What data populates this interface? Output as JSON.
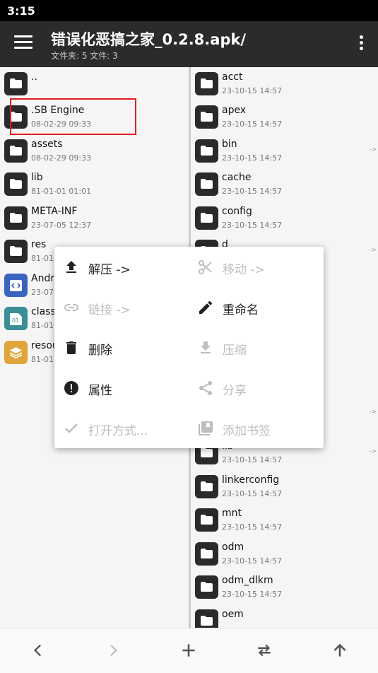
{
  "status": {
    "time": "3:15"
  },
  "header": {
    "title": "错误化恶搞之家_0.2.8.apk/",
    "subtitle": "文件夹: 5  文件: 3"
  },
  "left_pane": {
    "items": [
      {
        "name": "..",
        "date": ""
      },
      {
        "name": ".SB Engine",
        "date": "08-02-29 09:33"
      },
      {
        "name": "assets",
        "date": "08-02-29 09:33"
      },
      {
        "name": "lib",
        "date": "81-01-01 01:01"
      },
      {
        "name": "META-INF",
        "date": "23-07-05 12:37"
      },
      {
        "name": "res",
        "date": "81-01-"
      },
      {
        "name": "Andr",
        "date": "23-07-"
      },
      {
        "name": "class",
        "date": "81-01-"
      },
      {
        "name": "resou",
        "date": "81-01-"
      }
    ],
    "file_icon_labels": {
      "dex": "01"
    }
  },
  "right_pane": {
    "items": [
      {
        "name": "acct",
        "date": "23-10-15 14:57"
      },
      {
        "name": "apex",
        "date": "23-10-15 14:57"
      },
      {
        "name": "bin",
        "date": "23-10-15 14:57",
        "hint": "->"
      },
      {
        "name": "cache",
        "date": "23-10-15 14:57"
      },
      {
        "name": "config",
        "date": "23-10-15 14:57"
      },
      {
        "name": "d",
        "date": "",
        "hint": "->"
      },
      {
        "name": "lib",
        "date": "23-10-15 14:57",
        "hint": "->"
      },
      {
        "name": "linkerconfig",
        "date": "23-10-15 14:57"
      },
      {
        "name": "mnt",
        "date": "23-10-15 14:57"
      },
      {
        "name": "odm",
        "date": "23-10-15 14:57"
      },
      {
        "name": "odm_dlkm",
        "date": "23-10-15 14:57"
      },
      {
        "name": "oem",
        "date": ""
      }
    ],
    "extra_hint": "->"
  },
  "context_menu": {
    "items": [
      {
        "label": "解压 ->",
        "icon": "upload-icon",
        "enabled": true
      },
      {
        "label": "移动 ->",
        "icon": "scissors-icon",
        "enabled": false
      },
      {
        "label": "链接 ->",
        "icon": "link-icon",
        "enabled": false
      },
      {
        "label": "重命名",
        "icon": "pencil-icon",
        "enabled": true
      },
      {
        "label": "删除",
        "icon": "trash-icon",
        "enabled": true
      },
      {
        "label": "压缩",
        "icon": "download-icon",
        "enabled": false
      },
      {
        "label": "属性",
        "icon": "info-icon",
        "enabled": true
      },
      {
        "label": "分享",
        "icon": "share-icon",
        "enabled": false
      },
      {
        "label": "打开方式...",
        "icon": "check-icon",
        "enabled": false
      },
      {
        "label": "添加书签",
        "icon": "bookmark-icon",
        "enabled": false
      }
    ]
  },
  "bottom_bar": {
    "buttons": [
      "back-icon",
      "forward-icon",
      "add-icon",
      "swap-icon",
      "up-icon"
    ]
  },
  "colors": {
    "appbar": "#2b2b2b",
    "selection": "#e02020",
    "apk_icon": "#3a64c0",
    "dex_icon": "#3a8f96",
    "arsc_icon": "#e1a43a"
  }
}
